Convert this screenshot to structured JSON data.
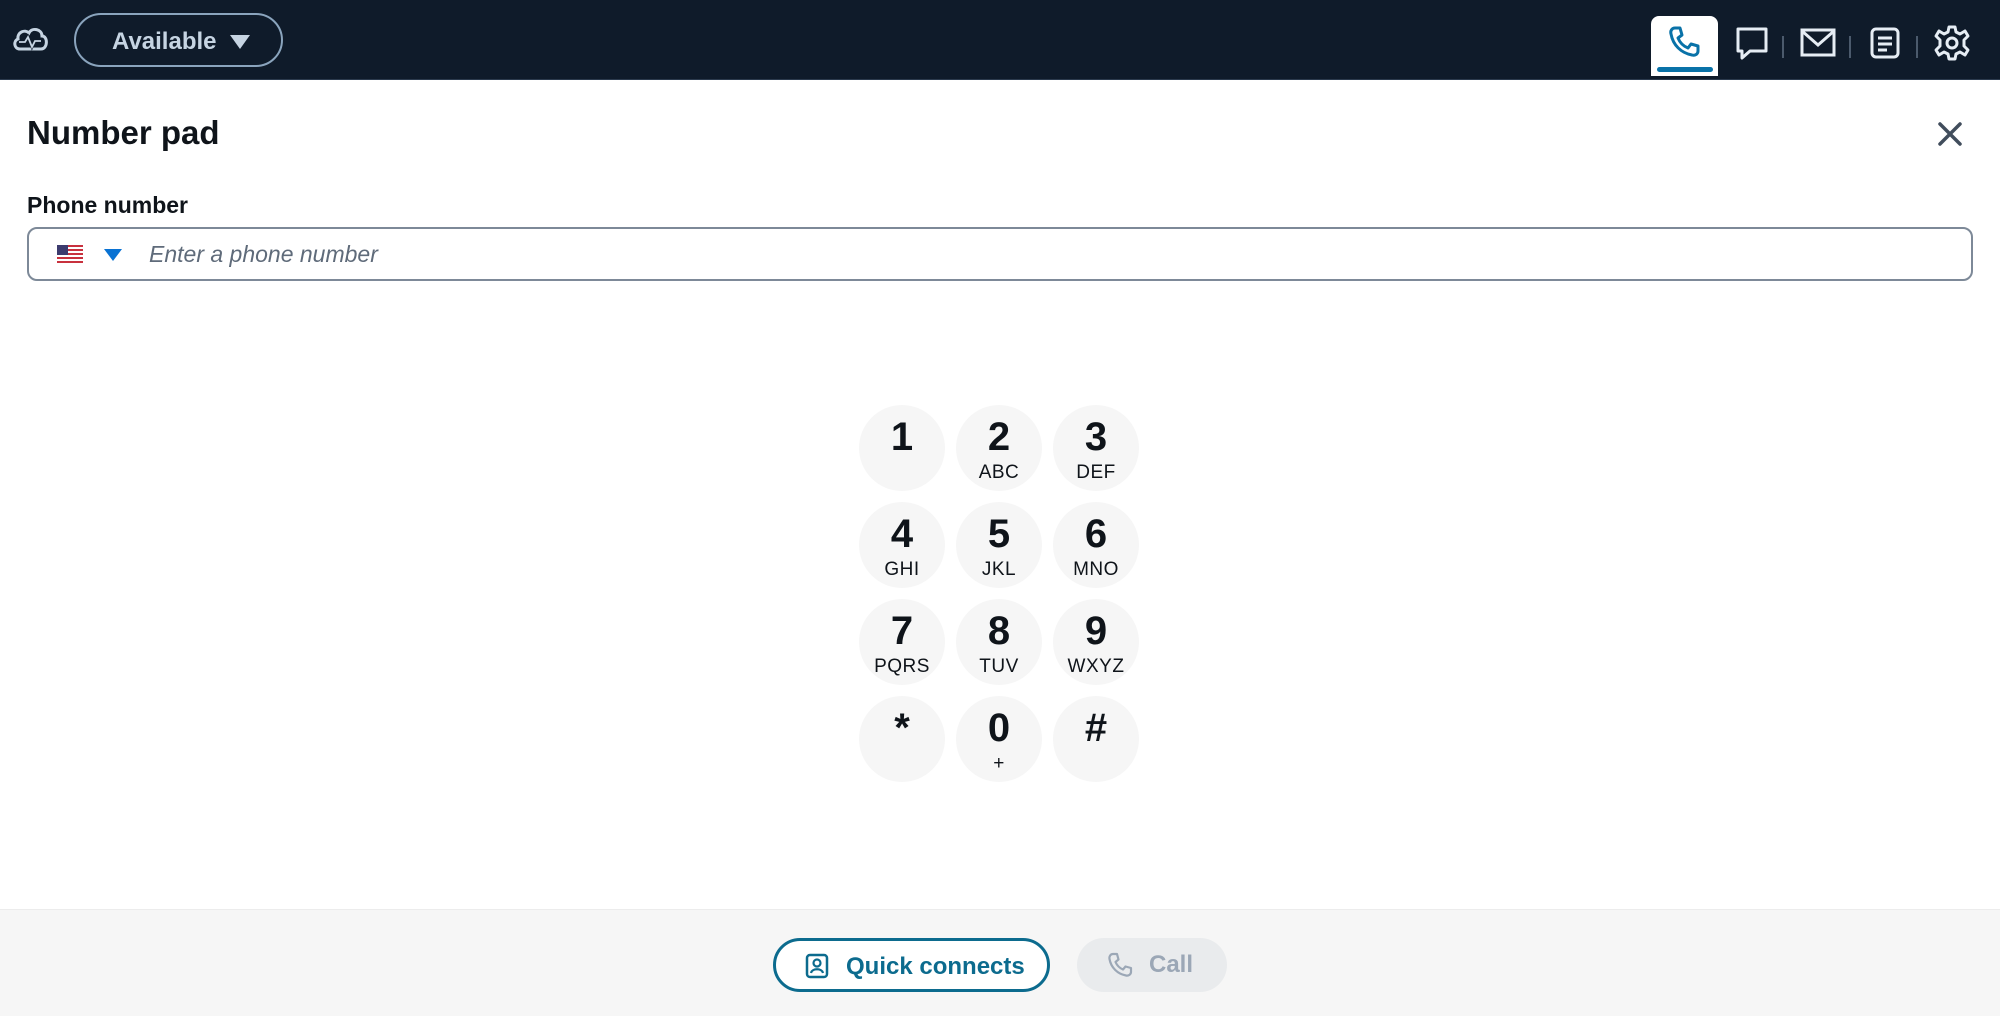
{
  "topbar": {
    "status_label": "Available",
    "nav_icons": [
      "phone-icon",
      "chat-icon",
      "mail-icon",
      "tasks-icon",
      "settings-icon"
    ],
    "active_tab": "phone"
  },
  "panel": {
    "title": "Number pad"
  },
  "phone_field": {
    "label": "Phone number",
    "placeholder": "Enter a phone number",
    "value": "",
    "country": "us-flag-icon"
  },
  "keypad": {
    "keys": [
      {
        "digit": "1",
        "letters": ""
      },
      {
        "digit": "2",
        "letters": "ABC"
      },
      {
        "digit": "3",
        "letters": "DEF"
      },
      {
        "digit": "4",
        "letters": "GHI"
      },
      {
        "digit": "5",
        "letters": "JKL"
      },
      {
        "digit": "6",
        "letters": "MNO"
      },
      {
        "digit": "7",
        "letters": "PQRS"
      },
      {
        "digit": "8",
        "letters": "TUV"
      },
      {
        "digit": "9",
        "letters": "WXYZ"
      },
      {
        "digit": "*",
        "letters": ""
      },
      {
        "digit": "0",
        "letters": "+"
      },
      {
        "digit": "#",
        "letters": ""
      }
    ]
  },
  "footer": {
    "quick_connects_label": "Quick connects",
    "call_label": "Call"
  },
  "colors": {
    "topbar_bg": "#0f1b2a",
    "accent": "#0972a8",
    "quick_connects": "#0c6b8e",
    "disabled_text": "#9ba7b6"
  }
}
